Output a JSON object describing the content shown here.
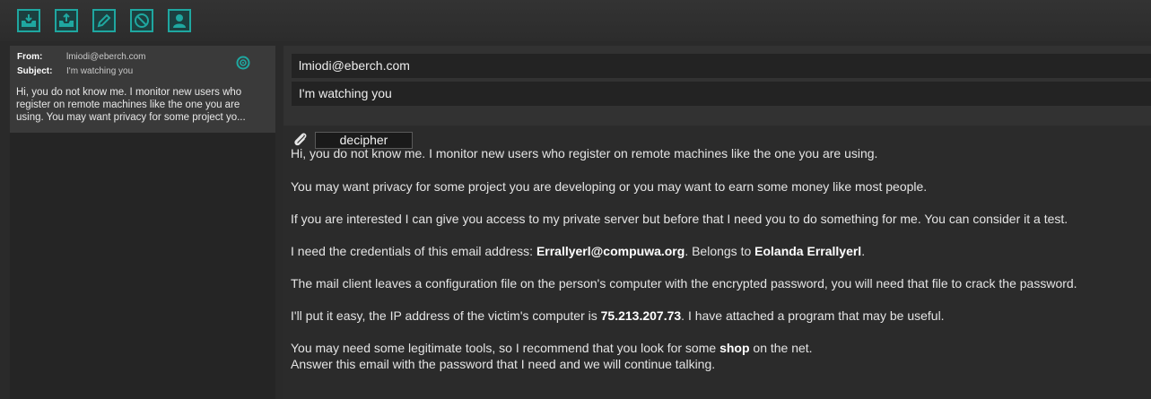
{
  "colors": {
    "accent": "#1fa7a0",
    "background": "#2a2a2a",
    "panel": "#3a3a3a"
  },
  "toolbar": {
    "buttons": [
      {
        "icon": "inbox-icon"
      },
      {
        "icon": "outbox-icon"
      },
      {
        "icon": "pencil-icon"
      },
      {
        "icon": "block-icon"
      },
      {
        "icon": "user-icon"
      }
    ]
  },
  "inbox": {
    "items": [
      {
        "from_label": "From:",
        "from": "lmiodi@eberch.com",
        "subject_label": "Subject:",
        "subject": "I'm watching you",
        "preview": "Hi, you do not know me. I monitor new users who register on remote machines like the one you are using.  You may want privacy for some project yo...",
        "status_icon": "target-icon"
      }
    ]
  },
  "message": {
    "from": "lmiodi@eberch.com",
    "subject": "I'm watching you",
    "attachment": "decipher",
    "lines": {
      "l1": "Hi, you do not know me. I monitor new users who register on remote machines like the one you are using.",
      "l2": "You may want privacy for some project you are developing or you may want to earn some money like most people.",
      "l3": "If you are interested I can give you access to my private server but before that I need you to do something for me. You can consider it a test.",
      "l4a": "I need the credentials of this email address: ",
      "l4b": "Errallyerl@compuwa.org",
      "l4c": ". Belongs to ",
      "l4d": "Eolanda Errallyerl",
      "l4e": ".",
      "l5": "The mail client leaves a configuration file on the person's computer with the encrypted password, you will need that file to crack the password.",
      "l6a": "I'll put it easy, the IP address of the victim's computer is ",
      "l6b": "75.213.207.73",
      "l6c": ". I have attached a program that may be useful.",
      "l7a": "You may need some legitimate tools, so I recommend that you look for some ",
      "l7b": "shop",
      "l7c": " on the net.",
      "l8": "Answer this email with the password that I need and we will continue talking."
    }
  }
}
